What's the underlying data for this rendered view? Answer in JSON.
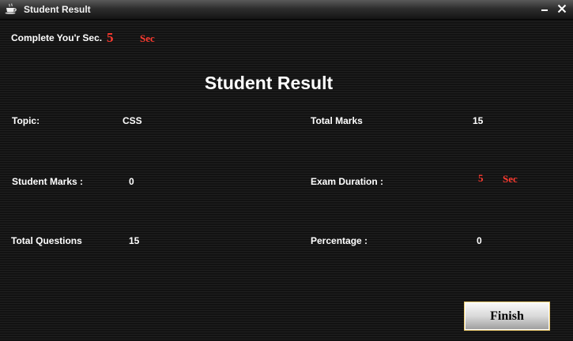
{
  "window": {
    "title": "Student Result",
    "icon": "coffee-cup-icon",
    "minimize_icon": "minimize-icon",
    "close_icon": "close-icon"
  },
  "timer": {
    "label": "Complete You'r Sec.",
    "value": "5",
    "unit": "Sec"
  },
  "heading": "Student Result",
  "fields": {
    "topic": {
      "label": "Topic:",
      "value": "CSS"
    },
    "total_marks": {
      "label": "Total Marks",
      "value": "15"
    },
    "student_marks": {
      "label": "Student Marks :",
      "value": "0"
    },
    "exam_duration": {
      "label": "Exam Duration :",
      "value": "5",
      "unit": "Sec"
    },
    "total_questions": {
      "label": "Total Questions",
      "value": "15"
    },
    "percentage": {
      "label": "Percentage :",
      "value": "0"
    }
  },
  "finish_button": {
    "label": "Finish"
  },
  "colors": {
    "background": "#161616",
    "text": "#ffffff",
    "accent_red": "#ff3b30",
    "button_border": "#e9c86a"
  }
}
